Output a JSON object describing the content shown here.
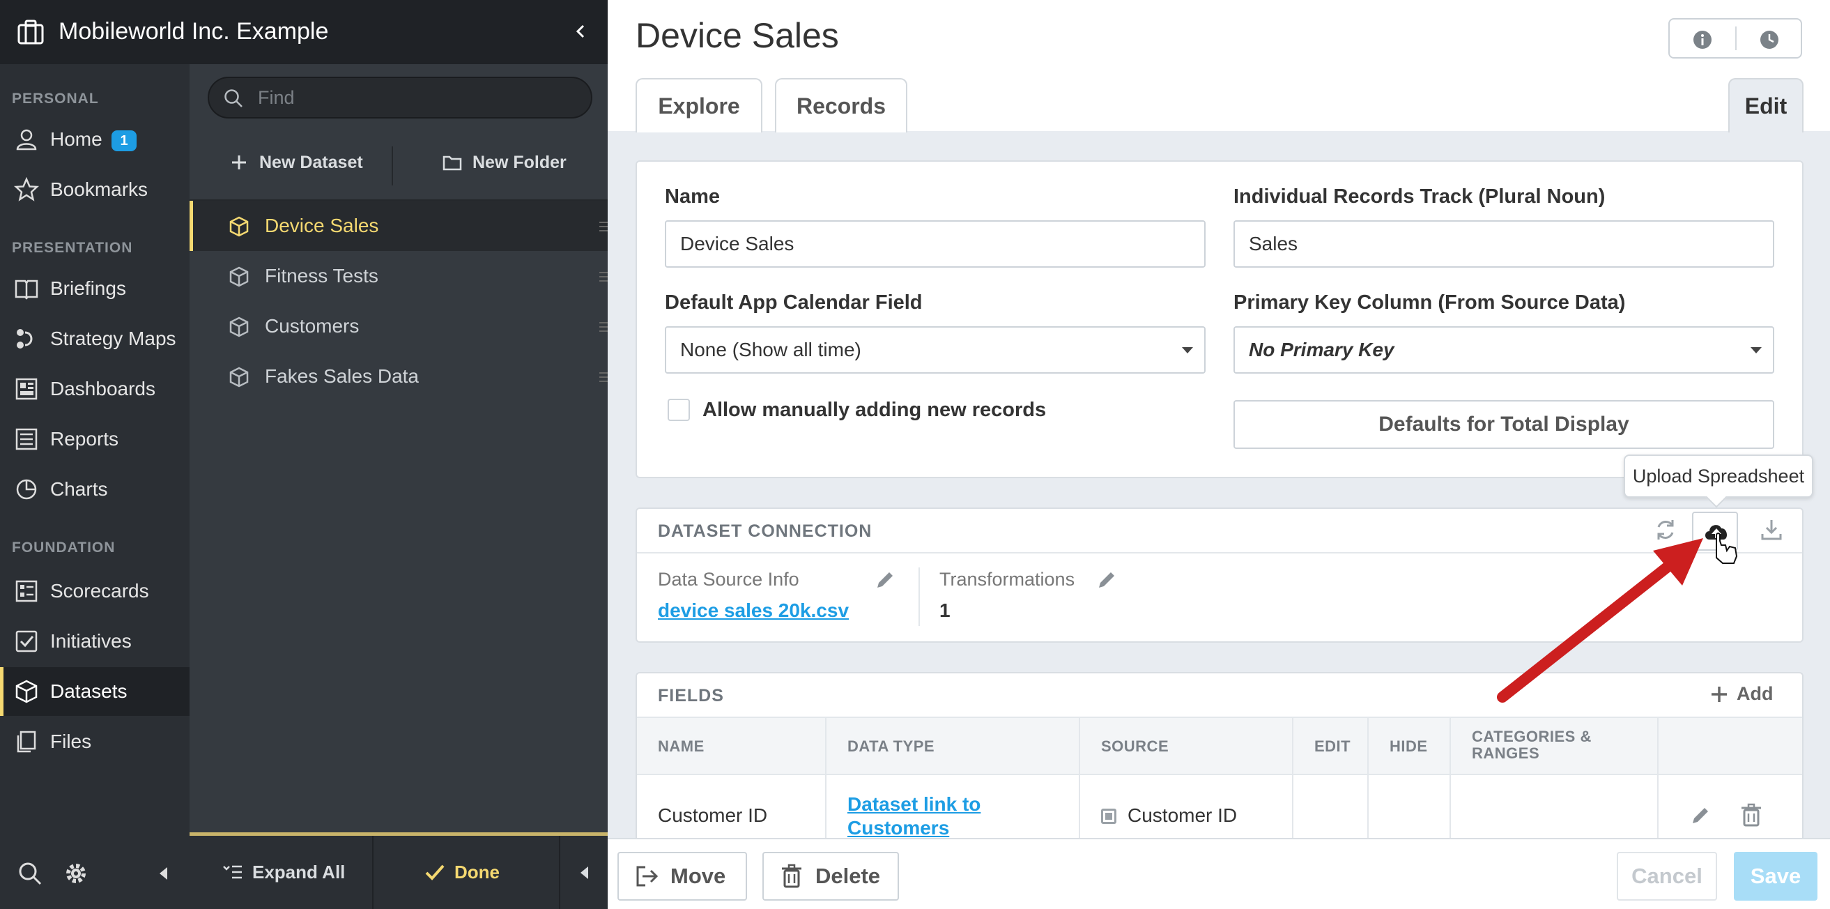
{
  "org": {
    "title": "Mobileworld Inc. Example"
  },
  "nav": {
    "sections": {
      "personal": "PERSONAL",
      "presentation": "PRESENTATION",
      "foundation": "FOUNDATION"
    },
    "items": [
      {
        "label": "Home",
        "icon": "person-icon"
      },
      {
        "label": "Bookmarks",
        "icon": "star-icon"
      },
      {
        "label": "Briefings",
        "icon": "book-icon"
      },
      {
        "label": "Strategy Maps",
        "icon": "strategy-map-icon"
      },
      {
        "label": "Dashboards",
        "icon": "dashboard-icon"
      },
      {
        "label": "Reports",
        "icon": "report-icon"
      },
      {
        "label": "Charts",
        "icon": "pie-chart-icon"
      },
      {
        "label": "Scorecards",
        "icon": "scorecard-icon"
      },
      {
        "label": "Initiatives",
        "icon": "checkbox-icon"
      },
      {
        "label": "Datasets",
        "icon": "cube-icon"
      },
      {
        "label": "Files",
        "icon": "files-icon"
      }
    ],
    "home_badge": "1"
  },
  "panel": {
    "search_placeholder": "Find",
    "new_dataset": "New Dataset",
    "new_folder": "New Folder",
    "datasets": [
      "Device Sales",
      "Fitness Tests",
      "Customers",
      "Fakes Sales Data"
    ],
    "expand_all": "Expand All",
    "done": "Done"
  },
  "page": {
    "title": "Device Sales",
    "tabs": {
      "explore": "Explore",
      "records": "Records",
      "edit": "Edit"
    }
  },
  "form": {
    "name_label": "Name",
    "name_value": "Device Sales",
    "records_label": "Individual Records Track (Plural Noun)",
    "records_value": "Sales",
    "calendar_label": "Default App Calendar Field",
    "calendar_value": "None (Show all time)",
    "pk_label": "Primary Key Column (From Source Data)",
    "pk_value": "No Primary Key",
    "allow_manual": "Allow manually adding new records",
    "defaults_button": "Defaults for Total Display"
  },
  "connection": {
    "title": "DATASET CONNECTION",
    "source_label": "Data Source Info",
    "source_file": "device sales 20k.csv",
    "transformations_label": "Transformations",
    "transformations_value": "1",
    "tooltip": "Upload Spreadsheet"
  },
  "fields": {
    "title": "FIELDS",
    "add": "Add",
    "columns": [
      "NAME",
      "DATA TYPE",
      "SOURCE",
      "EDIT",
      "HIDE",
      "CATEGORIES &",
      "RANGES"
    ],
    "rows": [
      {
        "name": "Customer ID",
        "data_type_line1": "Dataset link to",
        "data_type_line2": "Customers",
        "source": "Customer ID"
      }
    ]
  },
  "footer": {
    "move": "Move",
    "delete": "Delete",
    "cancel": "Cancel",
    "save": "Save"
  },
  "colors": {
    "accent": "#1d9de4",
    "highlight": "#f5d971",
    "arrow": "#cc1f1f"
  }
}
